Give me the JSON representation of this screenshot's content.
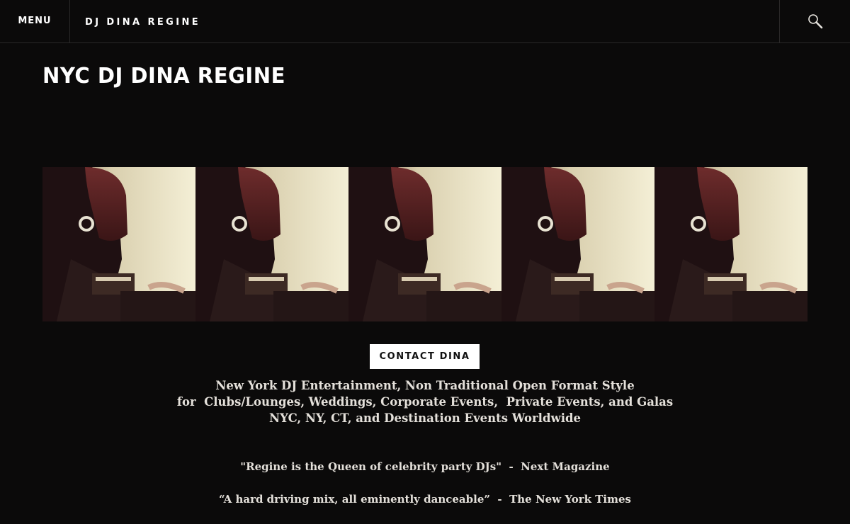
{
  "header": {
    "menu_label": "MENU",
    "site_name": "DJ DINA REGINE",
    "search_icon": "search-icon"
  },
  "main": {
    "page_title": "NYC DJ DINA REGINE",
    "banner_image": "repeated-photo-dj-at-mixer",
    "contact_label": "CONTACT DINA",
    "tagline": [
      "New York DJ Entertainment, Non Traditional Open Format Style",
      "for  Clubs/Lounges, Weddings, Corporate Events,  Private Events, and Galas",
      "NYC, NY, CT, and Destination Events Worldwide"
    ],
    "quotes": [
      "\"Regine is the Queen of celebrity party DJs\"  -  Next Magazine",
      "“A hard driving mix, all eminently danceable”  -  The New York Times"
    ]
  },
  "colors": {
    "background": "#0b0a0a",
    "text": "#e4e0da",
    "button_bg": "#ffffff",
    "button_text": "#111111"
  }
}
